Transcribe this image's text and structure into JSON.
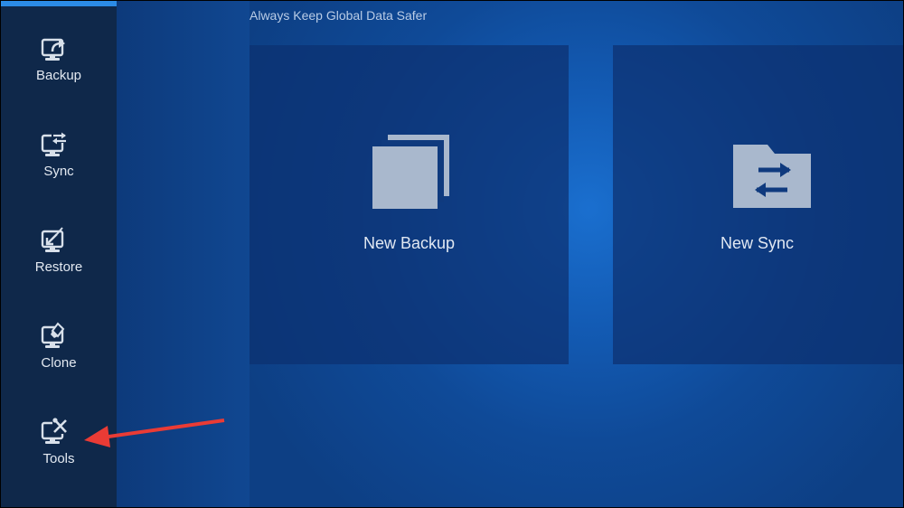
{
  "app": {
    "tagline": "Always Keep Global Data Safer"
  },
  "sidebar": {
    "items": [
      {
        "label": "Backup",
        "icon": "backup-icon"
      },
      {
        "label": "Sync",
        "icon": "sync-icon"
      },
      {
        "label": "Restore",
        "icon": "restore-icon"
      },
      {
        "label": "Clone",
        "icon": "clone-icon"
      },
      {
        "label": "Tools",
        "icon": "tools-icon"
      }
    ]
  },
  "main": {
    "tiles": [
      {
        "label": "New Backup",
        "icon": "copy-pages-icon"
      },
      {
        "label": "New Sync",
        "icon": "folder-sync-icon"
      }
    ]
  },
  "colors": {
    "sidebar_bg": "#0f284a",
    "accent": "#2b8be6",
    "annotation_arrow": "#ea3b35"
  }
}
